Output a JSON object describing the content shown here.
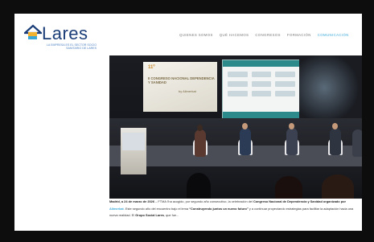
{
  "brand": {
    "name": "Lares",
    "tagline": "LA EMPRESA ES EL SECTOR SOCIO SANITARIO DE LARES"
  },
  "nav": {
    "items": [
      {
        "label": "QUIENES SOMOS",
        "active": false
      },
      {
        "label": "QUÉ HACEMOS",
        "active": false
      },
      {
        "label": "CONGRESOS",
        "active": false
      },
      {
        "label": "FORMACIÓN",
        "active": false
      },
      {
        "label": "COMUNICACIÓN",
        "active": true
      }
    ]
  },
  "photo": {
    "screen_number": "11º",
    "screen_title": "II CONGRESO NACIONAL DEPENDENCIA Y SANIDAD",
    "screen_sponsor": "by Alimerkat"
  },
  "article": {
    "lead": "Madrid, a 24 de marzo de 2026",
    "body1": "– FTMA l'ha acogido, por segundo año consecutivo, la celebración del",
    "event": "Congreso Nacional de Dependencia y Sanidad organizado por",
    "sponsor": "Alimerkat",
    "body2": ". Este segundo año del encuentro bajo el lema",
    "theme": "“Construyendo juntos un nuevo futuro”",
    "body3": "y a continuar proyectando estrategias para facilitar la adaptación hacia una nueva realidad. El",
    "group": "Grupo Social Lares",
    "body4": ", que fue..."
  },
  "colors": {
    "brand_blue": "#1b3e78",
    "accent_cyan": "#39a8d9"
  }
}
